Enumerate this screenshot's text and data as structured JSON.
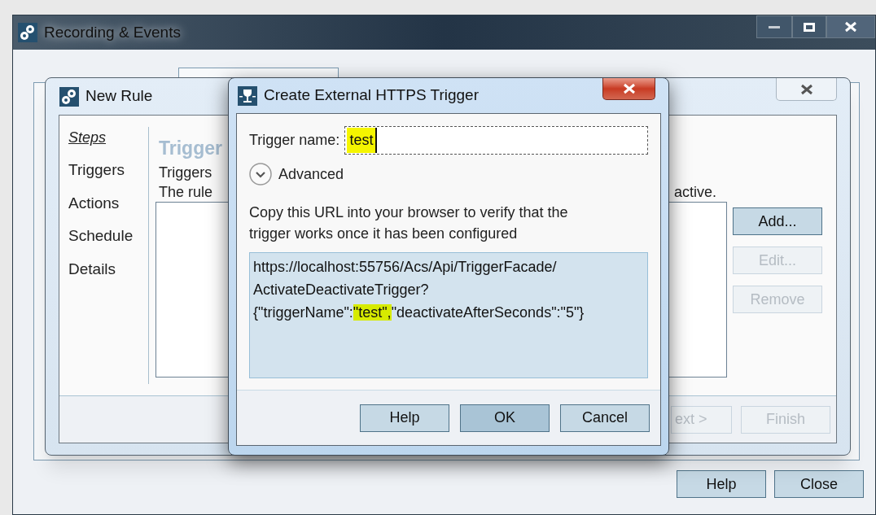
{
  "main_window": {
    "title": "Recording & Events",
    "buttons": [
      {
        "label": "Help",
        "disabled": false
      },
      {
        "label": "Close",
        "disabled": false
      }
    ]
  },
  "new_rule": {
    "title": "New Rule",
    "steps_heading": "Steps",
    "steps": [
      {
        "label": "Triggers",
        "selected": false
      },
      {
        "label": "Actions",
        "selected": false
      },
      {
        "label": "Schedule",
        "selected": false
      },
      {
        "label": "Details",
        "selected": false
      }
    ],
    "heading": "Trigger",
    "description_line_1": "Triggers",
    "description_line_2": "The rule",
    "description_line_2_end": "active.",
    "side_buttons": [
      {
        "label": "Add...",
        "disabled": false
      },
      {
        "label": "Edit...",
        "disabled": true
      },
      {
        "label": "Remove",
        "disabled": true
      }
    ],
    "footer_buttons": [
      {
        "label": "ext >",
        "disabled": true
      },
      {
        "label": "Finish",
        "disabled": true
      }
    ]
  },
  "trigger_dialog": {
    "title": "Create External HTTPS Trigger",
    "name_label": "Trigger name:",
    "name_field": {
      "value": "test",
      "highlighted": true
    },
    "advanced": {
      "label": "Advanced",
      "expanded": false
    },
    "instructions": "Copy this URL into your browser to verify that the trigger works once it has been configured",
    "url_lines": [
      [
        {
          "text": "https://localhost:55756/Acs/Api/TriggerFacade/",
          "highlighted": false
        }
      ],
      [
        {
          "text": "ActivateDeactivateTrigger?",
          "highlighted": false
        }
      ],
      [
        {
          "text": "{\"triggerName\":",
          "highlighted": false
        },
        {
          "text": "\"test\",",
          "highlighted": true
        },
        {
          "text": "\"deactivateAfterSeconds\":\"5\"}",
          "highlighted": false
        }
      ]
    ],
    "buttons": [
      {
        "label": "Help",
        "default": false
      },
      {
        "label": "OK",
        "default": true
      },
      {
        "label": "Cancel",
        "default": false
      }
    ]
  }
}
